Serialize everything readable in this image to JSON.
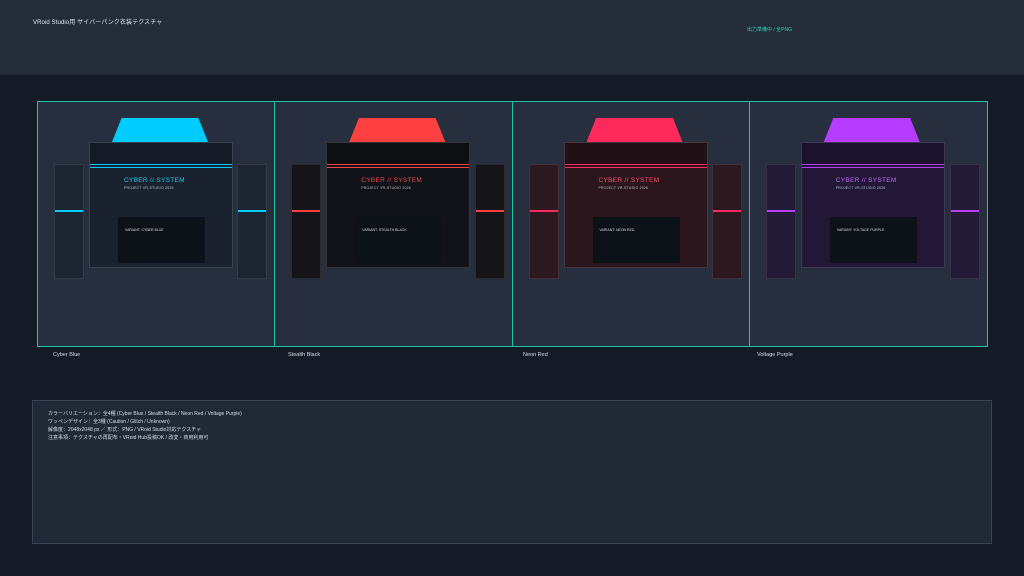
{
  "header": {
    "title": "VRoid Studio用 サイバーパンク衣装テクスチャ",
    "status": "出力準備中 / 全PNG"
  },
  "variants": [
    {
      "label": "Cyber Blue",
      "shirt_title": "CYBER // SYSTEM",
      "shirt_subtitle": "PROJECT VR-STUDIO 2026",
      "variant_text": "VARIANT: CYBER BLUE",
      "colors": {
        "accent": "#00ccff",
        "shirt": "#1a2230",
        "sleeve": "#1d2533",
        "title": "#26c6ea"
      }
    },
    {
      "label": "Stealth Black",
      "shirt_title": "CYBER // SYSTEM",
      "shirt_subtitle": "PROJECT VR-STUDIO 2026",
      "variant_text": "VARIANT: STEALTH BLACK",
      "colors": {
        "accent": "#ff4040",
        "shirt": "#121318",
        "sleeve": "#141419",
        "title": "#e84848"
      }
    },
    {
      "label": "Neon Red",
      "shirt_title": "CYBER // SYSTEM",
      "shirt_subtitle": "PROJECT VR-STUDIO 2026",
      "variant_text": "VARIANT: NEON RED",
      "colors": {
        "accent": "#ff2a5c",
        "shirt": "#2a161c",
        "sleeve": "#2c191f",
        "title": "#ff4a6e"
      }
    },
    {
      "label": "Voltage Purple",
      "shirt_title": "CYBER // SYSTEM",
      "shirt_subtitle": "PROJECT VR-STUDIO 2026",
      "variant_text": "VARIANT: VOLTAGE PURPLE",
      "colors": {
        "accent": "#b63cff",
        "shirt": "#221836",
        "sleeve": "#231a36",
        "title": "#c164f5"
      }
    }
  ],
  "info": {
    "line1": "カラーバリエーション：全4種 (Cyber Blue / Stealth Black / Neon Red / Voltage Purple)",
    "line2": "ワッペンデザイン：全3種 (Caution / Glitch / Unknown)",
    "line3": "解像度：2048x2048 px ／ 形式：PNG / VRoid Studio対応テクスチャ",
    "line4": "注意事項：テクスチャの再配布・VRoid Hub投稿OK / 改変・商用利用可"
  }
}
